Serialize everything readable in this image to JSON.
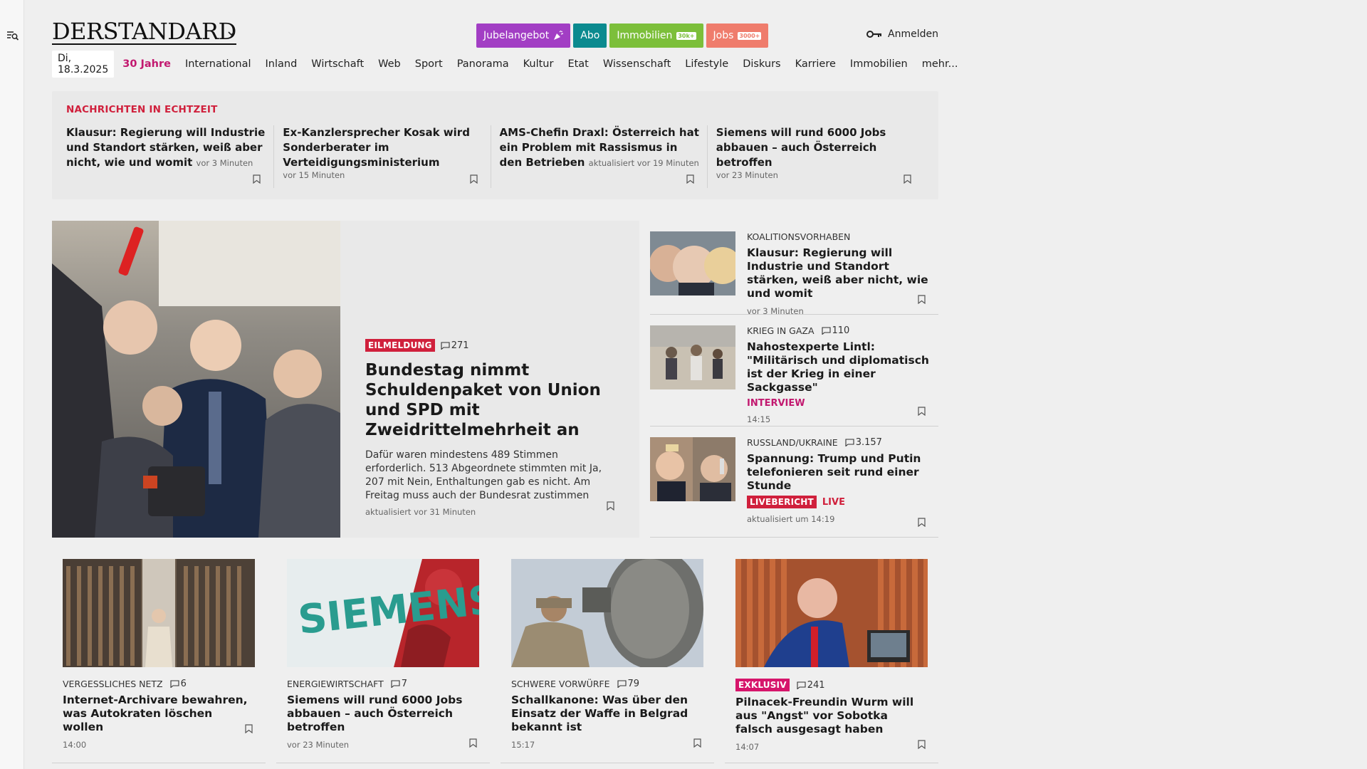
{
  "colors": {
    "accent_red": "#d0203c",
    "accent_pink": "#c2186f"
  },
  "logo": "DERSTANDARD",
  "promos": [
    {
      "label": "Jubelangebot",
      "badge": "",
      "color": "#a23ec4",
      "icon": "party-popper-icon"
    },
    {
      "label": "Abo",
      "badge": "",
      "color": "#0b8a8f"
    },
    {
      "label": "Immobilien",
      "badge": "30k+",
      "color": "#7cbf3a"
    },
    {
      "label": "Jobs",
      "badge": "3000+",
      "color": "#ef7c6c"
    }
  ],
  "login_label": "Anmelden",
  "nav": {
    "date": "Di, 18.3.2025",
    "items": [
      "30 Jahre",
      "International",
      "Inland",
      "Wirtschaft",
      "Web",
      "Sport",
      "Panorama",
      "Kultur",
      "Etat",
      "Wissenschaft",
      "Lifestyle",
      "Diskurs",
      "Karriere",
      "Immobilien",
      "mehr..."
    ]
  },
  "ticker": {
    "heading": "NACHRICHTEN IN ECHTZEIT",
    "items": [
      {
        "title": "Klausur: Regierung will Industrie und Standort stärken, weiß aber nicht, wie und womit",
        "time": "vor 3 Minuten"
      },
      {
        "title": "Ex-Kanzlersprecher Kosak wird Sonderberater im Verteidigungsministerium",
        "time": "vor 15 Minuten"
      },
      {
        "title": "AMS-Chefin Draxl: Österreich hat ein Problem mit Rassismus in den Betrieben",
        "time": "aktualisiert vor 19 Minuten"
      },
      {
        "title": "Siemens will rund 6000 Jobs abbauen – auch Österreich betroffen",
        "time": "vor 23 Minuten"
      }
    ]
  },
  "hero": {
    "tag": "EILMELDUNG",
    "comments": "271",
    "title": "Bundestag nimmt Schuldenpaket von Union und SPD mit Zweidrittelmehrheit an",
    "teaser": "Dafür waren mindestens 489 Stimmen erforderlich. 513 Abgeordnete stimmten mit Ja, 207 mit Nein, Enthaltungen gab es nicht. Am Freitag muss auch der Bundesrat zustimmen",
    "time": "aktualisiert vor 31 Minuten"
  },
  "side": [
    {
      "kicker": "KOALITIONSVORHABEN",
      "comments": "",
      "title": "Klausur: Regierung will Industrie und Standort stärken, weiß aber nicht, wie und womit",
      "label": "",
      "time": "vor 3 Minuten"
    },
    {
      "kicker": "KRIEG IN GAZA",
      "comments": "110",
      "title": "Nahostexperte Lintl: \"Militärisch und diplomatisch ist der Krieg in einer Sackgasse\"",
      "label": "INTERVIEW",
      "time": "14:15"
    },
    {
      "kicker": "RUSSLAND/UKRAINE",
      "comments": "3.157",
      "title": "Spannung: Trump und Putin telefonieren seit rund einer Stunde",
      "tag": "LIVEBERICHT",
      "label": "LIVE",
      "time": "aktualisiert um 14:19"
    }
  ],
  "cards": [
    {
      "kicker": "VERGESSLICHES NETZ",
      "comments": "6",
      "tag": "",
      "title": "Internet-Archivare bewahren, was Autokraten löschen wollen",
      "time": "14:00"
    },
    {
      "kicker": "ENERGIEWIRTSCHAFT",
      "comments": "7",
      "tag": "",
      "title": "Siemens will rund 6000 Jobs abbauen – auch Österreich betroffen",
      "time": "vor 23 Minuten",
      "image_text": "SIEMENS"
    },
    {
      "kicker": "SCHWERE VORWÜRFE",
      "comments": "79",
      "tag": "",
      "title": "Schallkanone: Was über den Einsatz der Waffe in Belgrad bekannt ist",
      "time": "15:17"
    },
    {
      "kicker": "",
      "comments": "241",
      "tag": "EXKLUSIV",
      "title": "Pilnacek-Freundin Wurm will aus \"Angst\" vor Sobotka falsch ausgesagt haben",
      "time": "14:07"
    }
  ]
}
